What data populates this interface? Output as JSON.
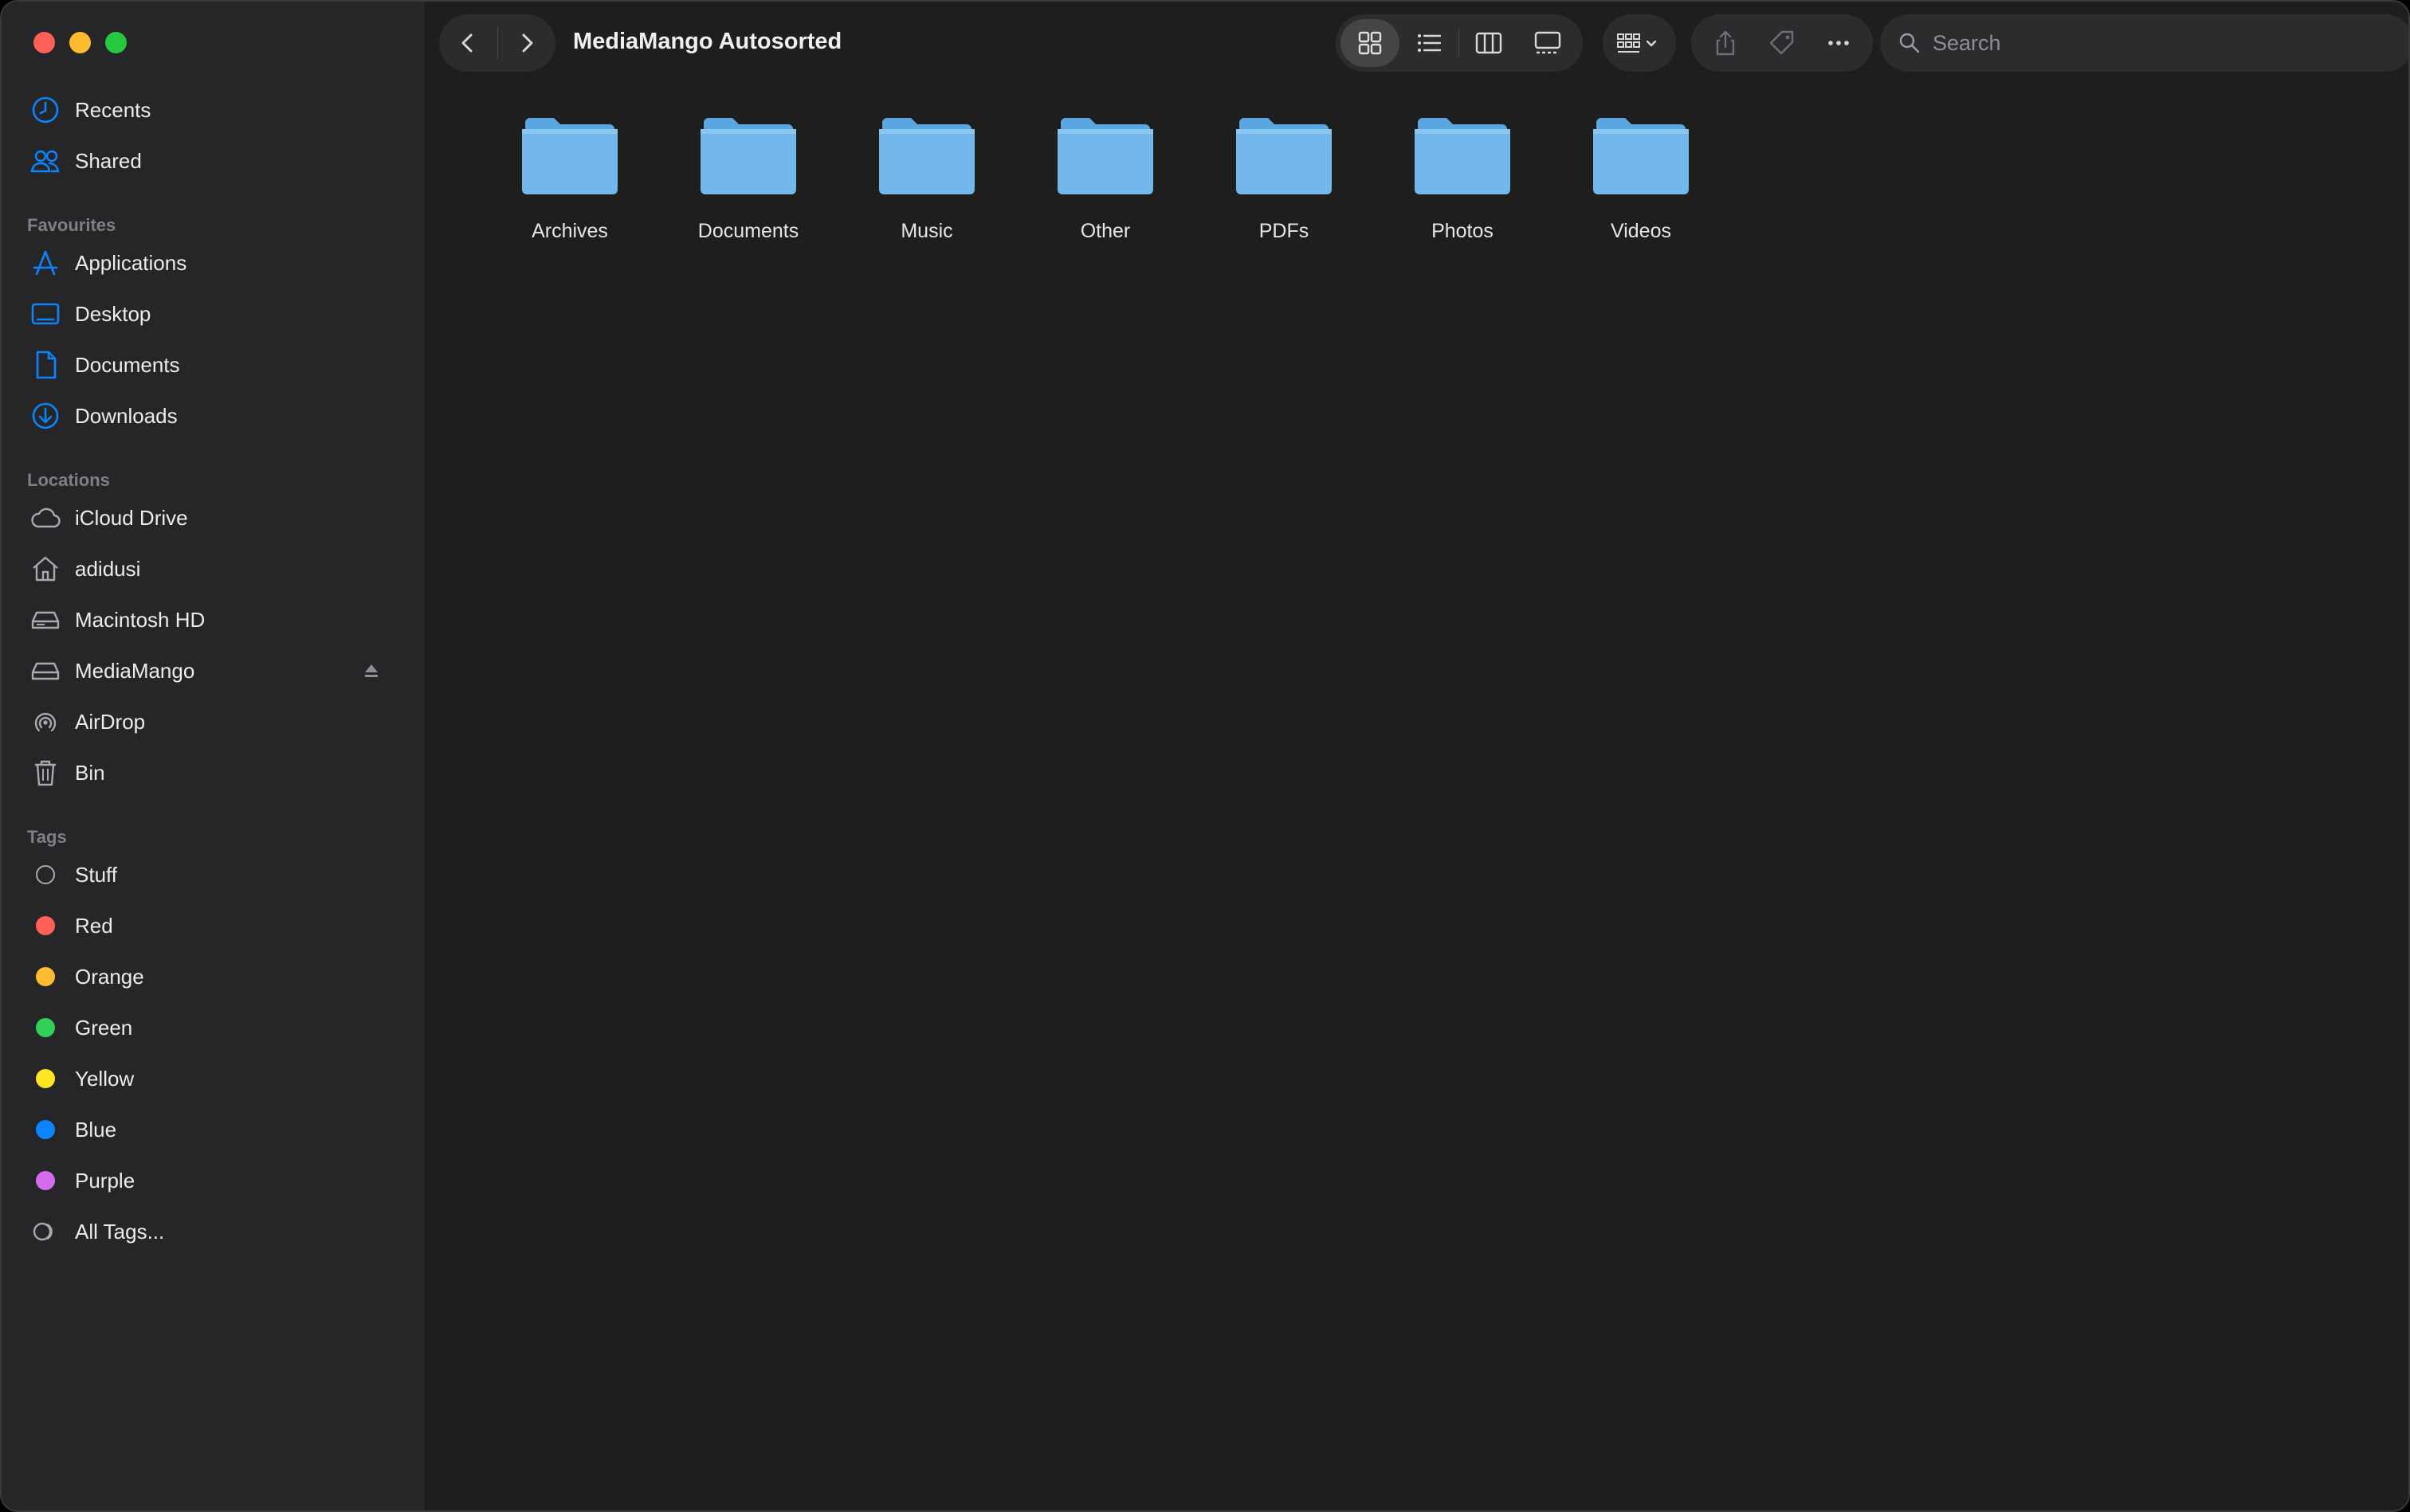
{
  "window": {
    "title": "MediaMango Autosorted"
  },
  "sidebar": {
    "top_items": [
      {
        "label": "Recents",
        "icon": "clock-icon"
      },
      {
        "label": "Shared",
        "icon": "people-icon"
      }
    ],
    "favourites_title": "Favourites",
    "favourites": [
      {
        "label": "Applications",
        "icon": "applications-icon"
      },
      {
        "label": "Desktop",
        "icon": "desktop-icon"
      },
      {
        "label": "Documents",
        "icon": "document-icon"
      },
      {
        "label": "Downloads",
        "icon": "download-icon"
      }
    ],
    "locations_title": "Locations",
    "locations": [
      {
        "label": "iCloud Drive",
        "icon": "cloud-icon"
      },
      {
        "label": "adidusi",
        "icon": "home-icon"
      },
      {
        "label": "Macintosh HD",
        "icon": "disk-icon"
      },
      {
        "label": "MediaMango",
        "icon": "external-disk-icon"
      },
      {
        "label": "AirDrop",
        "icon": "airdrop-icon"
      },
      {
        "label": "Bin",
        "icon": "trash-icon"
      }
    ],
    "tags_title": "Tags",
    "tags": [
      {
        "label": "Stuff",
        "color": ""
      },
      {
        "label": "Red",
        "color": "#ff5f57"
      },
      {
        "label": "Orange",
        "color": "#febc2e"
      },
      {
        "label": "Green",
        "color": "#30d158"
      },
      {
        "label": "Yellow",
        "color": "#ffe620"
      },
      {
        "label": "Blue",
        "color": "#0a84ff"
      },
      {
        "label": "Purple",
        "color": "#d56cf0"
      },
      {
        "label": "All Tags...",
        "color": ""
      }
    ]
  },
  "search": {
    "placeholder": "Search"
  },
  "folders": [
    {
      "label": "Archives"
    },
    {
      "label": "Documents"
    },
    {
      "label": "Music"
    },
    {
      "label": "Other"
    },
    {
      "label": "PDFs"
    },
    {
      "label": "Photos"
    },
    {
      "label": "Videos"
    }
  ],
  "colors": {
    "accent": "#0a84ff",
    "folder_body": "#72b8ec",
    "folder_tab": "#5aa6e0"
  }
}
